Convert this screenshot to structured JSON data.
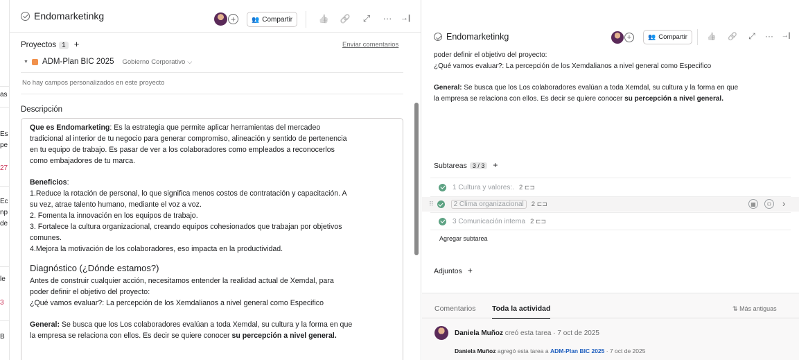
{
  "left_sliver": {
    "fragments": [
      "as",
      "Es",
      "pe",
      "27",
      "Ec",
      "np",
      "de",
      "le",
      "3",
      "B"
    ]
  },
  "task": {
    "title": "Endomarketinkg",
    "share_label": "Compartir",
    "share_icon": "people-icon",
    "header_icons": [
      "thumbs-up-icon",
      "link-icon",
      "expand-icon",
      "more-icon",
      "close-panel-icon"
    ],
    "header_glyphs": {
      "thumbs": "👍",
      "link": "🔗",
      "expand": "⤢",
      "more": "···",
      "close": "→|",
      "plus": "+"
    }
  },
  "projects": {
    "label": "Proyectos",
    "count": "1",
    "add_glyph": "+",
    "send_comments": "Enviar comentarios",
    "project_name": "ADM-Plan BIC 2025",
    "project_color": "#f1914c",
    "section_name": "Gobierno Corporativo",
    "no_fields": "No hay campos personalizados en este proyecto"
  },
  "description": {
    "label": "Descripción",
    "p1_bold": "Que es Endomarketing",
    "p1_rest": ": Es la estrategia que permite aplicar herramientas del mercadeo",
    "p1_l2": "tradicional al interior de tu negocio para generar compromiso, alineación y sentido de pertenencia",
    "p1_l3": "en tu equipo de trabajo. Es pasar de ver a los colaboradores como empleados a reconocerlos",
    "p1_l4": "como embajadores de tu marca.",
    "benef_bold": "Beneficios",
    "benef_colon": ":",
    "b1_l1": "1.Reduce la rotación de personal, lo que significa menos costos de contratación y capacitación. A",
    "b1_l2": "su vez, atrae talento humano, mediante el voz a voz.",
    "b2": "2. Fomenta la innovación en los equipos de trabajo.",
    "b3_l1": "3. Fortalece la cultura organizacional, creando equipos cohesionados que trabajan por objetivos",
    "b3_l2": "comunes.",
    "b4": "4.Mejora la motivación de los colaboradores, eso impacta en la productividad.",
    "diag_heading": "Diagnóstico (¿Dónde estamos?)",
    "diag_l1": "Antes de construir cualquier acción, necesitamos entender la realidad actual de Xemdal, para",
    "diag_l2": "poder definir el objetivo del proyecto:",
    "diag_l3": "¿Qué vamos evaluar?: La percepción de los Xemdalianos a nivel general como Especifico",
    "gen_bold": "General:",
    "gen_l1": " Se busca que los Los colaboradores evalúan a toda Xemdal, su cultura y la forma en que",
    "gen_l2_pre": "la empresa se relaciona con ellos. Es decir se quiere conocer ",
    "gen_l2_bold": "su percepción a nivel general."
  },
  "subtasks": {
    "label": "Subtareas",
    "count": "3 / 3",
    "add_glyph": "+",
    "items": [
      {
        "name": "1 Cultura y valores:.",
        "count": "2"
      },
      {
        "name": "2 Clima organizacional",
        "count": "2"
      },
      {
        "name": "3 Comunicación interna",
        "count": "2"
      }
    ],
    "add_label": "Agregar subtarea"
  },
  "attachments": {
    "label": "Adjuntos",
    "add_glyph": "+"
  },
  "activity": {
    "tabs": [
      "Comentarios",
      "Toda la actividad"
    ],
    "sort_label": "Más antiguas",
    "sort_glyph": "⇅",
    "e1_user": "Daniela Muñoz",
    "e1_text": " creó esta tarea · 7 oct de 2025",
    "e2_user": "Daniela Muñoz",
    "e2_text": " agregó esta tarea a ",
    "e2_link": "ADM-Plan BIC 2025",
    "e2_tail": " · 7 oct de 2025"
  },
  "glyphs": {
    "caret_down": "▼",
    "chev_down": "⌵",
    "subtask_icon": "⊏⊐",
    "calendar": "▦",
    "person": "⚇",
    "chev_right": "›",
    "drag": "⠿"
  },
  "colors": {
    "done_green": "#5da283",
    "link_blue": "#1f5fbf",
    "avatar": "#5a2a59"
  }
}
